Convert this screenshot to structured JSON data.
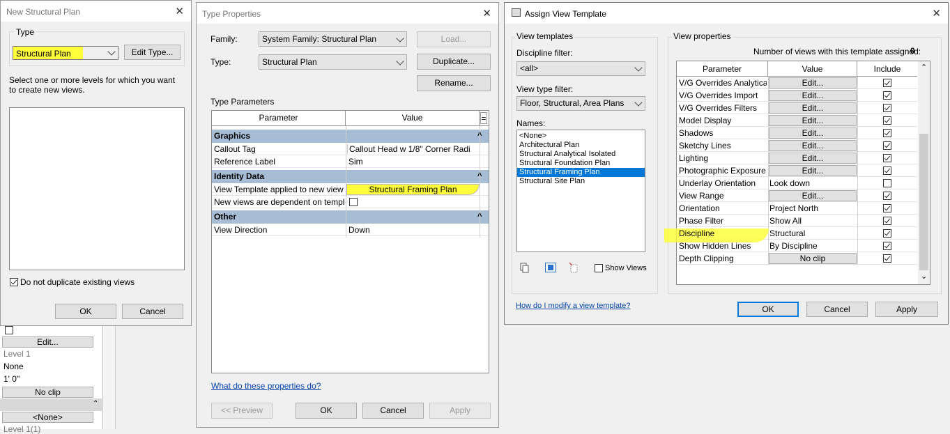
{
  "bg_panel": {
    "values": [
      "Edit...",
      "Level 1",
      "None",
      "1'  0\"",
      "No clip",
      "<None>",
      "Level 1(1)"
    ]
  },
  "new_plan": {
    "title": "New Structural Plan",
    "type_group": "Type",
    "type_value": "Structural Plan",
    "edit_type": "Edit Type...",
    "instructions": "Select one or more levels for which you want to create new views.",
    "dont_duplicate": "Do not duplicate existing views",
    "ok": "OK",
    "cancel": "Cancel"
  },
  "type_props": {
    "title": "Type Properties",
    "family_label": "Family:",
    "family_value": "System Family: Structural Plan",
    "type_label": "Type:",
    "type_value": "Structural Plan",
    "load": "Load...",
    "duplicate": "Duplicate...",
    "rename": "Rename...",
    "type_parameters": "Type Parameters",
    "col_parameter": "Parameter",
    "col_value": "Value",
    "col_eq": "=",
    "groups": [
      {
        "name": "Graphics",
        "rows": [
          {
            "param": "Callout Tag",
            "value": "Callout Head w 1/8\" Corner Radi"
          },
          {
            "param": "Reference Label",
            "value": "Sim"
          }
        ]
      },
      {
        "name": "Identity Data",
        "rows": [
          {
            "param": "View Template applied to new view",
            "value": "Structural Framing Plan"
          },
          {
            "param": "New views are dependent on templ",
            "value": ""
          }
        ]
      },
      {
        "name": "Other",
        "rows": [
          {
            "param": "View Direction",
            "value": "Down"
          }
        ]
      }
    ],
    "help_link": "What do these properties do?",
    "preview": "<< Preview",
    "ok": "OK",
    "cancel": "Cancel",
    "apply": "Apply"
  },
  "assign": {
    "title": "Assign View Template",
    "view_templates": "View templates",
    "discipline_filter_label": "Discipline filter:",
    "discipline_filter_value": "<all>",
    "view_type_filter_label": "View type filter:",
    "view_type_filter_value": "Floor, Structural, Area Plans",
    "names_label": "Names:",
    "names": [
      "<None>",
      "Architectural Plan",
      "Structural Analytical Isolated",
      "Structural Foundation Plan",
      "Structural Framing Plan",
      "Structural Site Plan"
    ],
    "selected_name": "Structural Framing Plan",
    "show_views": "Show Views",
    "view_properties": "View properties",
    "num_views_label": "Number of views with this template assigned:",
    "num_views": "0",
    "col_parameter": "Parameter",
    "col_value": "Value",
    "col_include": "Include",
    "rows": [
      {
        "param": "V/G Overrides Analytica",
        "value": "Edit...",
        "button": true,
        "include": true
      },
      {
        "param": "V/G Overrides Import",
        "value": "Edit...",
        "button": true,
        "include": true
      },
      {
        "param": "V/G Overrides Filters",
        "value": "Edit...",
        "button": true,
        "include": true
      },
      {
        "param": "Model Display",
        "value": "Edit...",
        "button": true,
        "include": true
      },
      {
        "param": "Shadows",
        "value": "Edit...",
        "button": true,
        "include": true
      },
      {
        "param": "Sketchy Lines",
        "value": "Edit...",
        "button": true,
        "include": true
      },
      {
        "param": "Lighting",
        "value": "Edit...",
        "button": true,
        "include": true
      },
      {
        "param": "Photographic Exposure",
        "value": "Edit...",
        "button": true,
        "include": true
      },
      {
        "param": "Underlay Orientation",
        "value": "Look down",
        "button": false,
        "include": false
      },
      {
        "param": "View Range",
        "value": "Edit...",
        "button": true,
        "include": true
      },
      {
        "param": "Orientation",
        "value": "Project North",
        "button": false,
        "include": true
      },
      {
        "param": "Phase Filter",
        "value": "Show All",
        "button": false,
        "include": true
      },
      {
        "param": "Discipline",
        "value": "Structural",
        "button": false,
        "include": true
      },
      {
        "param": "Show Hidden Lines",
        "value": "By Discipline",
        "button": false,
        "include": true
      },
      {
        "param": "Depth Clipping",
        "value": "No clip",
        "button": true,
        "include": true
      }
    ],
    "help_link": "How do I modify a view template?",
    "ok": "OK",
    "cancel": "Cancel",
    "apply": "Apply"
  },
  "colors": {
    "highlight": "#ffff3c",
    "selection": "#0078d7",
    "group_header": "#a7bdd6",
    "link": "#0645ad"
  }
}
